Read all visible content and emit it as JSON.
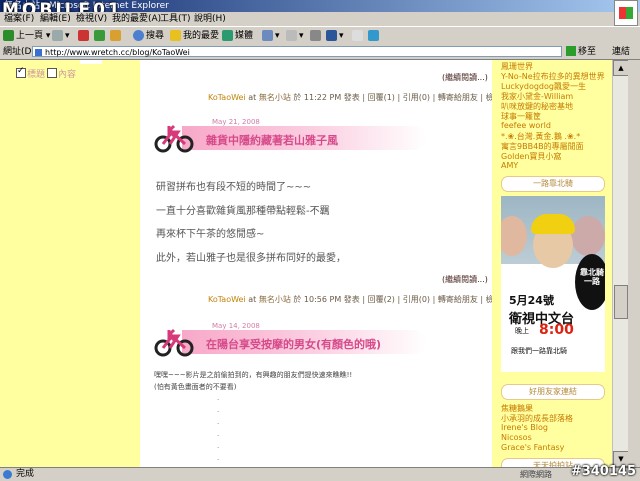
{
  "window": {
    "title": "無名小站 - Microsoft Internet Explorer",
    "watermark": "MOBILE01"
  },
  "menu": [
    "檔案(F)",
    "編輯(E)",
    "檢視(V)",
    "我的最愛(A)",
    "工具(T)",
    "說明(H)"
  ],
  "toolbar": {
    "back": "上一頁",
    "search": "搜尋",
    "favorites": "我的最愛",
    "media": "媒體"
  },
  "address": {
    "label": "網址(D)",
    "url": "http://www.wretch.cc/blog/KoTaoWei",
    "go": "移至",
    "links": "連結"
  },
  "left": {
    "chk1": "標題",
    "chk2": "內容"
  },
  "post0": {
    "continue": "(繼續閱讀...)"
  },
  "post1": {
    "author": "KoTaoWei",
    "at": "at",
    "site": "無名小站",
    "ts": "於 11:22 PM",
    "cat": "發表",
    "reply": "回覆(1)",
    "ref": "引用(0)",
    "tell": "轉寄給朋友",
    "report": "檢舉",
    "date": "May 21, 2008",
    "title": "雜貨中隱約藏著若山雅子風",
    "body": [
      "研習拼布也有段不短的時間了~~~",
      "一直十分喜歡雜貨風那種帶點輕鬆-不羈",
      "再來杯下午茶的悠閒感~",
      "此外，若山雅子也是很多拼布同好的最愛，"
    ],
    "continue": "(繼續閱讀...)"
  },
  "post2": {
    "author": "KoTaoWei",
    "at": "at",
    "site": "無名小站",
    "ts": "於 10:56 PM",
    "cat": "發表",
    "reply": "回覆(2)",
    "ref": "引用(0)",
    "tell": "轉寄給朋友",
    "report": "檢舉",
    "date": "May 14, 2008",
    "title": "在陽台享受按摩的男女(有顏色的哦)",
    "body": [
      "嘿嘿~~~影片是之前偷拍到的，有興趣的朋友們提快速來瞧瞧!!",
      "(怕有黃色畫面者的不要看)"
    ]
  },
  "right": {
    "links_top": [
      "鳳珊世界",
      "Y-No-Ne拉布拉多的異想世界",
      "Luckydogdog飄愛一生",
      "我家小黛金-William",
      "叭咪放鍵的秘密基地",
      "球事一籮筐",
      "feefee world",
      "*.❀.台灣.黃金.鵝 .❀.*",
      "寓言9BB4B的專屬閒面",
      "Golden寶貝小窩",
      "AMY"
    ],
    "sec1": "一路靠北騎",
    "promo": {
      "circle": "靠北騎一路",
      "date": "5月24號",
      "channel": "衛視中文台",
      "time_pre": "晚上",
      "time": "8:00",
      "tagline": "跟我們一路靠北騎"
    },
    "sec2": "好朋友家連結",
    "links_bottom": [
      "焦糖鵝果",
      "小承羽的成長部落格",
      "Irene's Blog",
      "Nicosos",
      "Grace's Fantasy"
    ],
    "sec3": "天天拍拍站"
  },
  "status": {
    "text": "完成",
    "zone": "網際網路",
    "id": "#340145"
  }
}
